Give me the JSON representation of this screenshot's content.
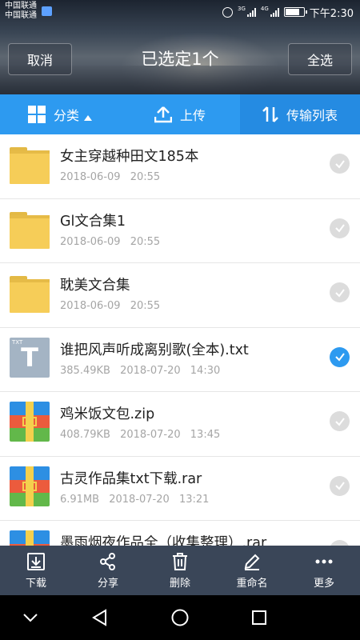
{
  "status_bar": {
    "carrier_1": "中国联通",
    "carrier_2": "中国联通",
    "net_1": "3G",
    "net_2": "4G",
    "time": "下午2:30"
  },
  "header": {
    "cancel_label": "取消",
    "title": "已选定1个",
    "select_all_label": "全选"
  },
  "toolbar": {
    "category_label": "分类",
    "upload_label": "上传",
    "transfer_label": "传输列表"
  },
  "files": [
    {
      "name": "女主穿越种田文185本",
      "size": "",
      "date": "2018-06-09",
      "time": "20:55",
      "type": "folder",
      "selected": false
    },
    {
      "name": "Gl文合集1",
      "size": "",
      "date": "2018-06-09",
      "time": "20:55",
      "type": "folder",
      "selected": false
    },
    {
      "name": "耽美文合集",
      "size": "",
      "date": "2018-06-09",
      "time": "20:55",
      "type": "folder",
      "selected": false
    },
    {
      "name": "谁把风声听成离别歌(全本).txt",
      "size": "385.49KB",
      "date": "2018-07-20",
      "time": "14:30",
      "type": "txt",
      "selected": true
    },
    {
      "name": "鸡米饭文包.zip",
      "size": "408.79KB",
      "date": "2018-07-20",
      "time": "13:45",
      "type": "zip",
      "selected": false
    },
    {
      "name": "古灵作品集txt下载.rar",
      "size": "6.91MB",
      "date": "2018-07-20",
      "time": "13:21",
      "type": "zip",
      "selected": false
    },
    {
      "name": "墨雨烟夜作品全（收集整理）.rar",
      "size": "",
      "date": "",
      "time": "",
      "type": "zip",
      "selected": false
    }
  ],
  "txt_icon_label": "TXT",
  "actions": {
    "download": "下载",
    "share": "分享",
    "delete": "删除",
    "rename": "重命名",
    "more": "更多"
  },
  "colors": {
    "accent": "#2d9af0",
    "action_bar": "#3a4658"
  }
}
